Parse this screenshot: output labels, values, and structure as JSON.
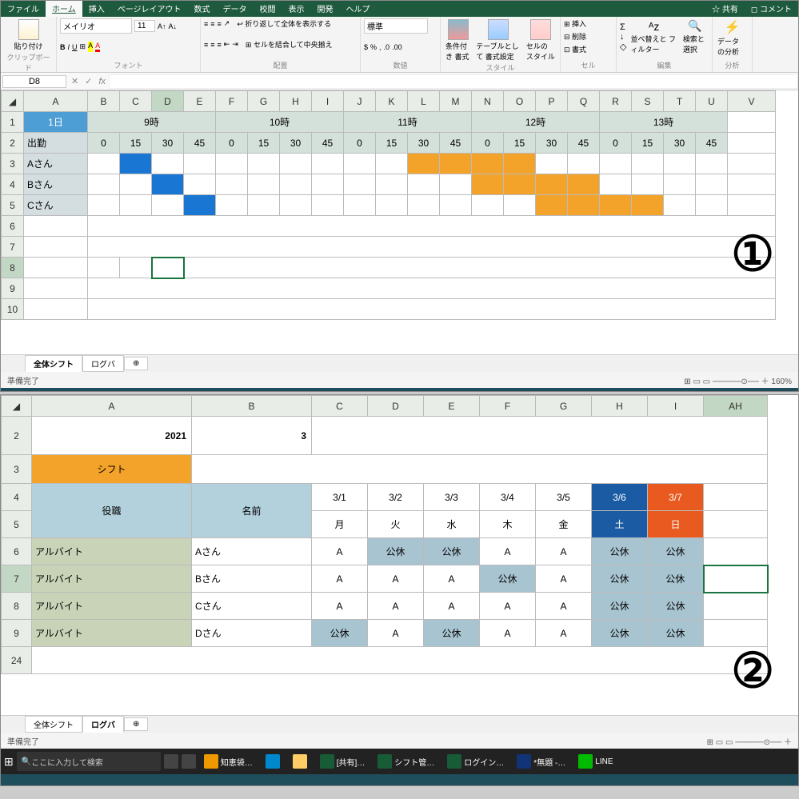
{
  "ribbon": {
    "tabs": [
      "ファイル",
      "ホーム",
      "挿入",
      "ページレイアウト",
      "数式",
      "データ",
      "校閲",
      "表示",
      "開発",
      "ヘルプ"
    ],
    "share": "共有",
    "comment": "コメント",
    "paste": "貼り付け",
    "clipboard": "クリップボード",
    "font_name": "メイリオ",
    "font_size": "11",
    "font_group": "フォント",
    "align_group": "配置",
    "wrap": "折り返して全体を表示する",
    "merge": "セルを結合して中央揃え",
    "num_format": "標準",
    "num_group": "数値",
    "cond_fmt": "条件付き\n書式",
    "tbl_fmt": "テーブルとして\n書式設定",
    "cell_style": "セルの\nスタイル",
    "style_group": "スタイル",
    "insert": "挿入",
    "delete": "削除",
    "format": "書式",
    "cell_group": "セル",
    "sort": "並べ替えと\nフィルター",
    "find": "検索と\n選択",
    "edit_group": "編集",
    "analyze": "データ\nの分析",
    "analyze_group": "分析"
  },
  "top": {
    "namebox": "D8",
    "cols": [
      "A",
      "B",
      "C",
      "D",
      "E",
      "F",
      "G",
      "H",
      "I",
      "J",
      "K",
      "L",
      "M",
      "N",
      "O",
      "P",
      "Q",
      "R",
      "S",
      "T",
      "U",
      "V"
    ],
    "rows": [
      "1",
      "2",
      "3",
      "4",
      "5",
      "6",
      "7",
      "8",
      "9",
      "10"
    ],
    "day": "1日",
    "shift_label": "出勤",
    "hours": [
      "9時",
      "10時",
      "11時",
      "12時",
      "13時"
    ],
    "mins": [
      "0",
      "15",
      "30",
      "45",
      "0",
      "15",
      "30",
      "45",
      "0",
      "15",
      "30",
      "45",
      "0",
      "15",
      "30",
      "45",
      "0",
      "15",
      "30",
      "45"
    ],
    "people": [
      "Aさん",
      "Bさん",
      "Cさん"
    ],
    "tabs": [
      "全体シフト",
      "ログバ"
    ],
    "status": "準備完了",
    "circled": "①"
  },
  "bottom": {
    "cols": [
      "A",
      "B",
      "C",
      "D",
      "E",
      "F",
      "G",
      "H",
      "I",
      "AH"
    ],
    "rows": [
      "2",
      "3",
      "4",
      "5",
      "6",
      "7",
      "8",
      "9",
      "24"
    ],
    "year": "2021",
    "month": "3",
    "shift": "シフト",
    "role": "役職",
    "name": "名前",
    "dates": [
      "3/1",
      "3/2",
      "3/3",
      "3/4",
      "3/5",
      "3/6",
      "3/7"
    ],
    "wdays": [
      "月",
      "火",
      "水",
      "木",
      "金",
      "土",
      "日"
    ],
    "role_val": "アルバイト",
    "names": [
      "Aさん",
      "Bさん",
      "Cさん",
      "Dさん"
    ],
    "A": "A",
    "off": "公休",
    "tabs": [
      "全体シフト",
      "ログバ"
    ],
    "status": "準備完了",
    "circled": "②"
  },
  "taskbar": {
    "search_ph": "ここに入力して検索",
    "items": [
      "知恵袋…",
      "",
      "",
      "[共有]…",
      "シフト管…",
      "ログイン…",
      "*無題 -…",
      "LINE"
    ]
  }
}
